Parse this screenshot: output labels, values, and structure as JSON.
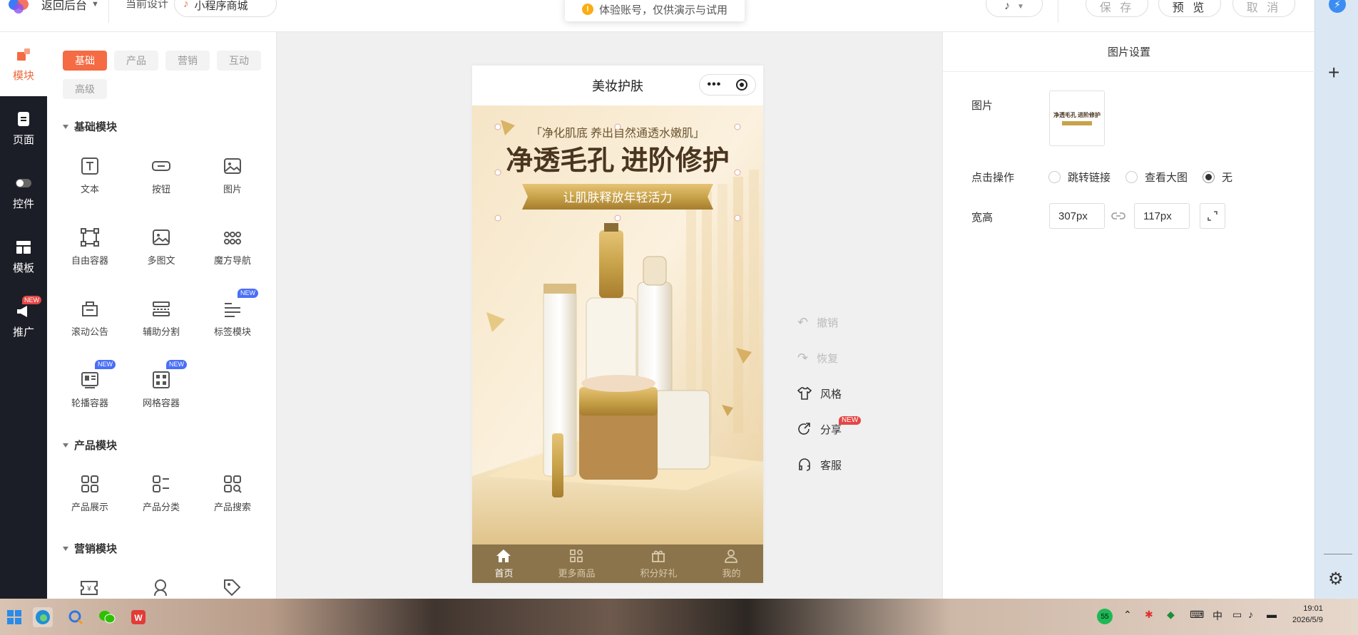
{
  "topbar": {
    "back_label": "返回后台",
    "current_design_label": "当前设计",
    "current_design_value": "小程序商城",
    "toast_text": "体验账号，仅供演示与试用",
    "save_label": "保 存",
    "preview_label": "预 览",
    "cancel_label": "取 消"
  },
  "leftnav": [
    {
      "label": "模块"
    },
    {
      "label": "页面"
    },
    {
      "label": "控件"
    },
    {
      "label": "模板"
    },
    {
      "label": "推广",
      "badge": "NEW"
    }
  ],
  "modules_panel": {
    "tabs": [
      "基础",
      "产品",
      "营销",
      "互动",
      "高级"
    ],
    "sections": {
      "basic": {
        "title": "基础模块",
        "items": [
          {
            "label": "文本"
          },
          {
            "label": "按钮"
          },
          {
            "label": "图片"
          },
          {
            "label": "自由容器"
          },
          {
            "label": "多图文"
          },
          {
            "label": "魔方导航"
          },
          {
            "label": "滚动公告"
          },
          {
            "label": "辅助分割"
          },
          {
            "label": "标签模块",
            "badge": "NEW"
          },
          {
            "label": "轮播容器",
            "badge": "NEW"
          },
          {
            "label": "网格容器",
            "badge": "NEW"
          }
        ]
      },
      "product": {
        "title": "产品模块",
        "items": [
          {
            "label": "产品展示"
          },
          {
            "label": "产品分类"
          },
          {
            "label": "产品搜索"
          }
        ]
      },
      "marketing": {
        "title": "营销模块"
      }
    }
  },
  "phone": {
    "title": "美妆护肤",
    "banner": {
      "tagline": "「净化肌底 养出自然通透水嫩肌」",
      "headline": "净透毛孔 进阶修护",
      "ribbon": "让肌肤释放年轻活力"
    },
    "tabbar": [
      {
        "label": "首页",
        "active": true
      },
      {
        "label": "更多商品",
        "active": false
      },
      {
        "label": "积分好礼",
        "active": false
      },
      {
        "label": "我的",
        "active": false
      }
    ]
  },
  "tools": {
    "undo": "撤销",
    "redo": "恢复",
    "style": "风格",
    "share": "分享",
    "share_badge": "NEW",
    "service": "客服"
  },
  "props": {
    "title": "图片设置",
    "image_label": "图片",
    "thumb_caption": "净透毛孔 进阶修护",
    "click_action_label": "点击操作",
    "options": [
      "跳转链接",
      "查看大图",
      "无"
    ],
    "selected_option": "无",
    "size_label": "宽高",
    "width_value": "307px",
    "height_value": "117px"
  },
  "taskbar": {
    "badge": "55",
    "ime": "中",
    "time": "19:01",
    "date": "2026/5/9"
  },
  "colors": {
    "accent": "#f46b44",
    "tabbar": "#8b744b",
    "gold": "#c9a34a"
  }
}
